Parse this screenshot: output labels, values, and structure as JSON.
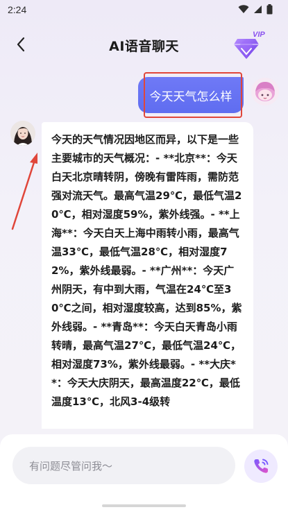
{
  "status_bar": {
    "time": "2:24",
    "icons": [
      "wifi-icon",
      "signal-icon",
      "battery-icon"
    ]
  },
  "header": {
    "back_icon": "chevron-left-icon",
    "title": "AI语音聊天",
    "vip_label": "VIP",
    "vip_icon": "diamond-icon"
  },
  "chat": {
    "user_message": "今天天气怎么样",
    "ai_message": "今天的天气情况因地区而异，以下是一些主要城市的天气概况：- **北京**：今天白天北京晴转阴，傍晚有雷阵雨，需防范强对流天气。最高气温29℃，最低气温20℃，相对湿度59%，紫外线强。- **上海**：今天白天上海中雨转小雨，最高气温33℃，最低气温28℃，相对湿度72%，紫外线最弱。- **广州**：今天广州阴天，有中到大雨，气温在24℃至30℃之间，相对湿度较高，达到85%，紫外线弱。- **青岛**：今天白天青岛小雨转晴，最高气温27℃，最低气温24℃，相对湿度73%，紫外线最弱。- **大庆**：今天大庆阴天，最高温度22℃，最低温度13℃，北风3-4级转"
  },
  "input": {
    "placeholder": "有问题尽管问我～",
    "call_icon": "phone-call-icon"
  },
  "colors": {
    "accent": "#6470f3",
    "annotation": "#e0463a",
    "vip": "#8a52ef"
  }
}
